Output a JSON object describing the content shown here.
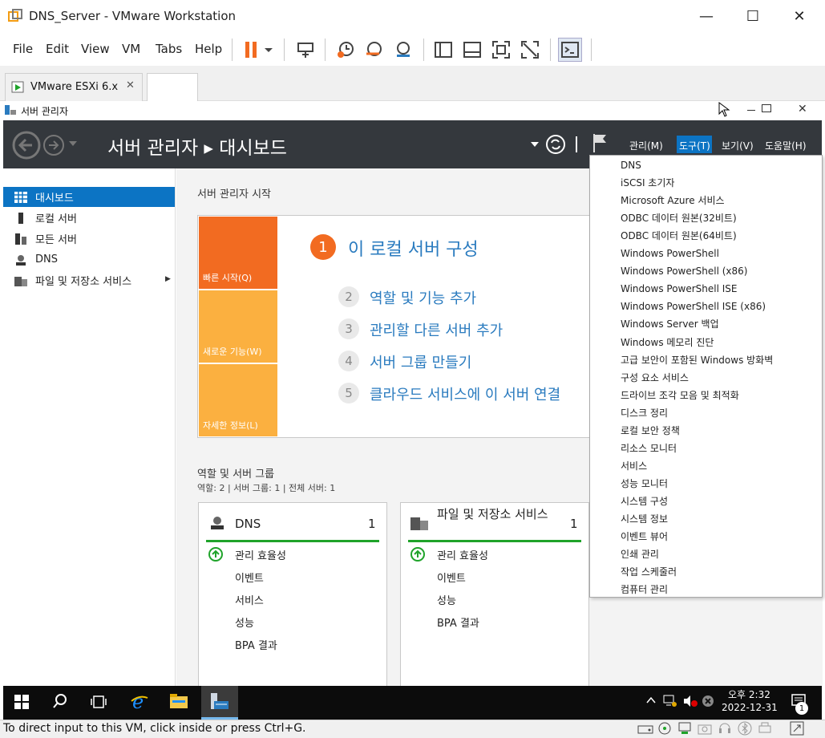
{
  "window": {
    "title": "DNS_Server - VMware Workstation",
    "minimize": "—",
    "maximize": "☐",
    "close": "✕"
  },
  "menubar": [
    "File",
    "Edit",
    "View",
    "VM",
    "Tabs",
    "Help"
  ],
  "tabs": {
    "vm_tab": "VMware ESXi 6.x",
    "close": "✕"
  },
  "guest": {
    "title": "서버 관리자",
    "header_title": "서버 관리자 ▸ 대시보드",
    "header_menu": [
      "관리(M)",
      "도구(T)",
      "보기(V)",
      "도움말(H)"
    ],
    "sidebar": [
      {
        "label": "대시보드",
        "selected": true,
        "icon": "dashboard-icon"
      },
      {
        "label": "로컬 서버",
        "icon": "local-server-icon"
      },
      {
        "label": "모든 서버",
        "icon": "all-servers-icon"
      },
      {
        "label": "DNS",
        "icon": "dns-icon"
      },
      {
        "label": "파일 및 저장소 서비스",
        "icon": "file-storage-icon",
        "arrow": "▶"
      }
    ],
    "welcome_title": "서버 관리자 시작",
    "tiles": [
      "빠른 시작(Q)",
      "새로운 기능(W)",
      "자세한 정보(L)"
    ],
    "steps": [
      {
        "num": "1",
        "label": "이 로컬 서버 구성"
      },
      {
        "num": "2",
        "label": "역할 및 기능 추가"
      },
      {
        "num": "3",
        "label": "관리할 다른 서버 추가"
      },
      {
        "num": "4",
        "label": "서버 그룹 만들기"
      },
      {
        "num": "5",
        "label": "클라우드 서비스에 이 서버 연결"
      }
    ],
    "roles_title": "역할 및 서버 그룹",
    "roles_sub": "역할: 2   |   서버 그룹: 1   |   전체 서버: 1",
    "cards": [
      {
        "title": "DNS",
        "count": "1",
        "rows": [
          "관리 효율성",
          "이벤트",
          "서비스",
          "성능",
          "BPA 결과"
        ]
      },
      {
        "title": "파일 및 저장소 서비스",
        "count": "1",
        "rows": [
          "관리 효율성",
          "이벤트",
          "성능",
          "BPA 결과"
        ]
      }
    ],
    "tools_menu": [
      "DNS",
      "iSCSI 초기자",
      "Microsoft Azure 서비스",
      "ODBC 데이터 원본(32비트)",
      "ODBC 데이터 원본(64비트)",
      "Windows PowerShell",
      "Windows PowerShell (x86)",
      "Windows PowerShell ISE",
      "Windows PowerShell ISE (x86)",
      "Windows Server 백업",
      "Windows 메모리 진단",
      "고급 보안이 포함된 Windows 방화벽",
      "구성 요소 서비스",
      "드라이브 조각 모음 및 최적화",
      "디스크 정리",
      "로컬 보안 정책",
      "리소스 모니터",
      "서비스",
      "성능 모니터",
      "시스템 구성",
      "시스템 정보",
      "이벤트 뷰어",
      "인쇄 관리",
      "작업 스케줄러",
      "컴퓨터 관리"
    ]
  },
  "taskbar": {
    "time": "오후 2:32",
    "date": "2022-12-31",
    "notif_count": "1"
  },
  "statusbar": {
    "text": "To direct input to this VM, click inside or press Ctrl+G."
  },
  "colors": {
    "accent": "#0c74c4",
    "orange": "#f26b21",
    "tile": "#fbb040",
    "header": "#34383d",
    "ok": "#1fa32a"
  }
}
